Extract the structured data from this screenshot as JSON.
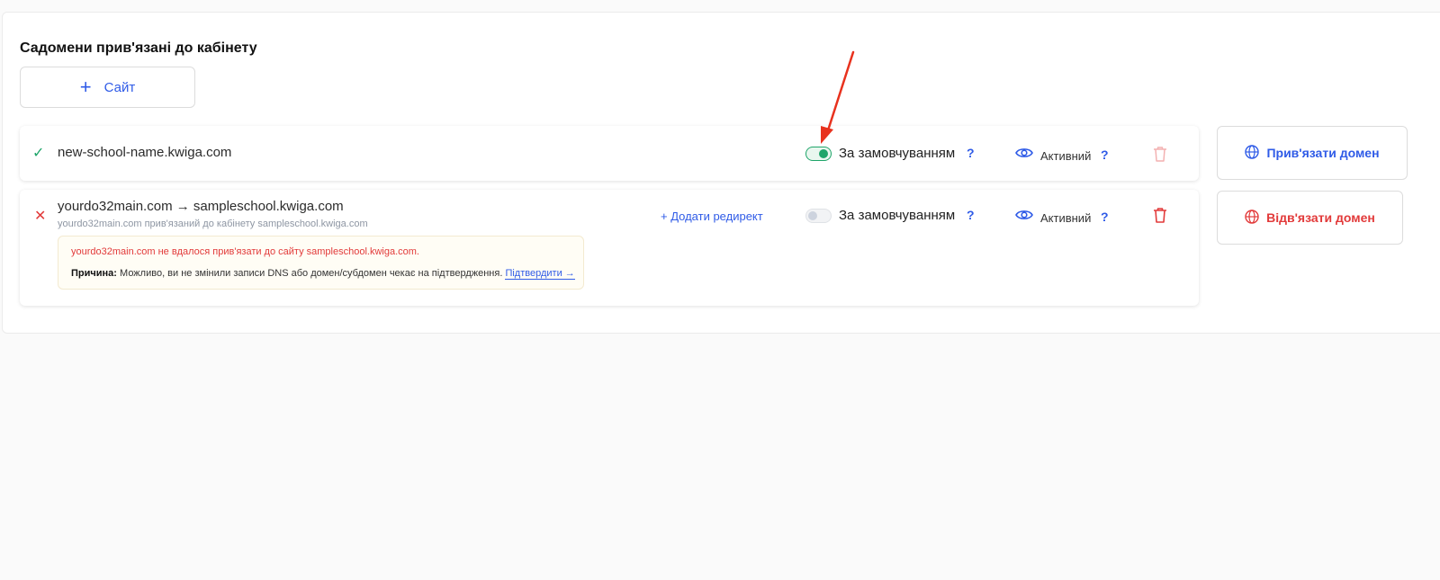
{
  "section": {
    "title": "Садомени прив'язані до кабінету",
    "add_button_icon": "plus-icon",
    "add_button_label": "Сайт"
  },
  "domains": [
    {
      "status": "ok",
      "status_icon": "check-icon",
      "domain": "new-school-name.kwiga.com",
      "default_toggle": true,
      "default_label": "За замовчуванням",
      "help_mark": "?",
      "visibility_icon": "eye-icon",
      "active_label": "Активний",
      "delete_icon": "trash-icon",
      "delete_enabled": false
    },
    {
      "status": "error",
      "status_icon": "cross-icon",
      "domain": "yourdo32main.com",
      "arrow": "→",
      "target": "sampleschool.kwiga.com",
      "subtitle": "yourdo32main.com прив'язаний до кабінету sampleschool.kwiga.com",
      "add_redirect_label": "+ Додати редирект",
      "default_toggle": false,
      "default_label": "За замовчуванням",
      "help_mark": "?",
      "visibility_icon": "eye-icon",
      "active_label": "Активний",
      "delete_icon": "trash-icon",
      "delete_enabled": true,
      "error_message": "yourdo32main.com не вдалося прив'язати до сайту sampleschool.kwiga.com.",
      "reason_label": "Причина:",
      "reason_text": "Можливо, ви не змінили записи DNS або домен/субдомен чекає на підтвердження.",
      "confirm_link": "Підтвердити →"
    }
  ],
  "actions": {
    "bind_label": "Прив'язати домен",
    "bind_icon": "globe-icon",
    "unbind_label": "Відв'язати домен",
    "unbind_icon": "globe-icon"
  },
  "colors": {
    "accent": "#2f5be7",
    "success": "#1fa56a",
    "danger": "#e23a3a",
    "annotation_arrow": "#e8321e"
  }
}
